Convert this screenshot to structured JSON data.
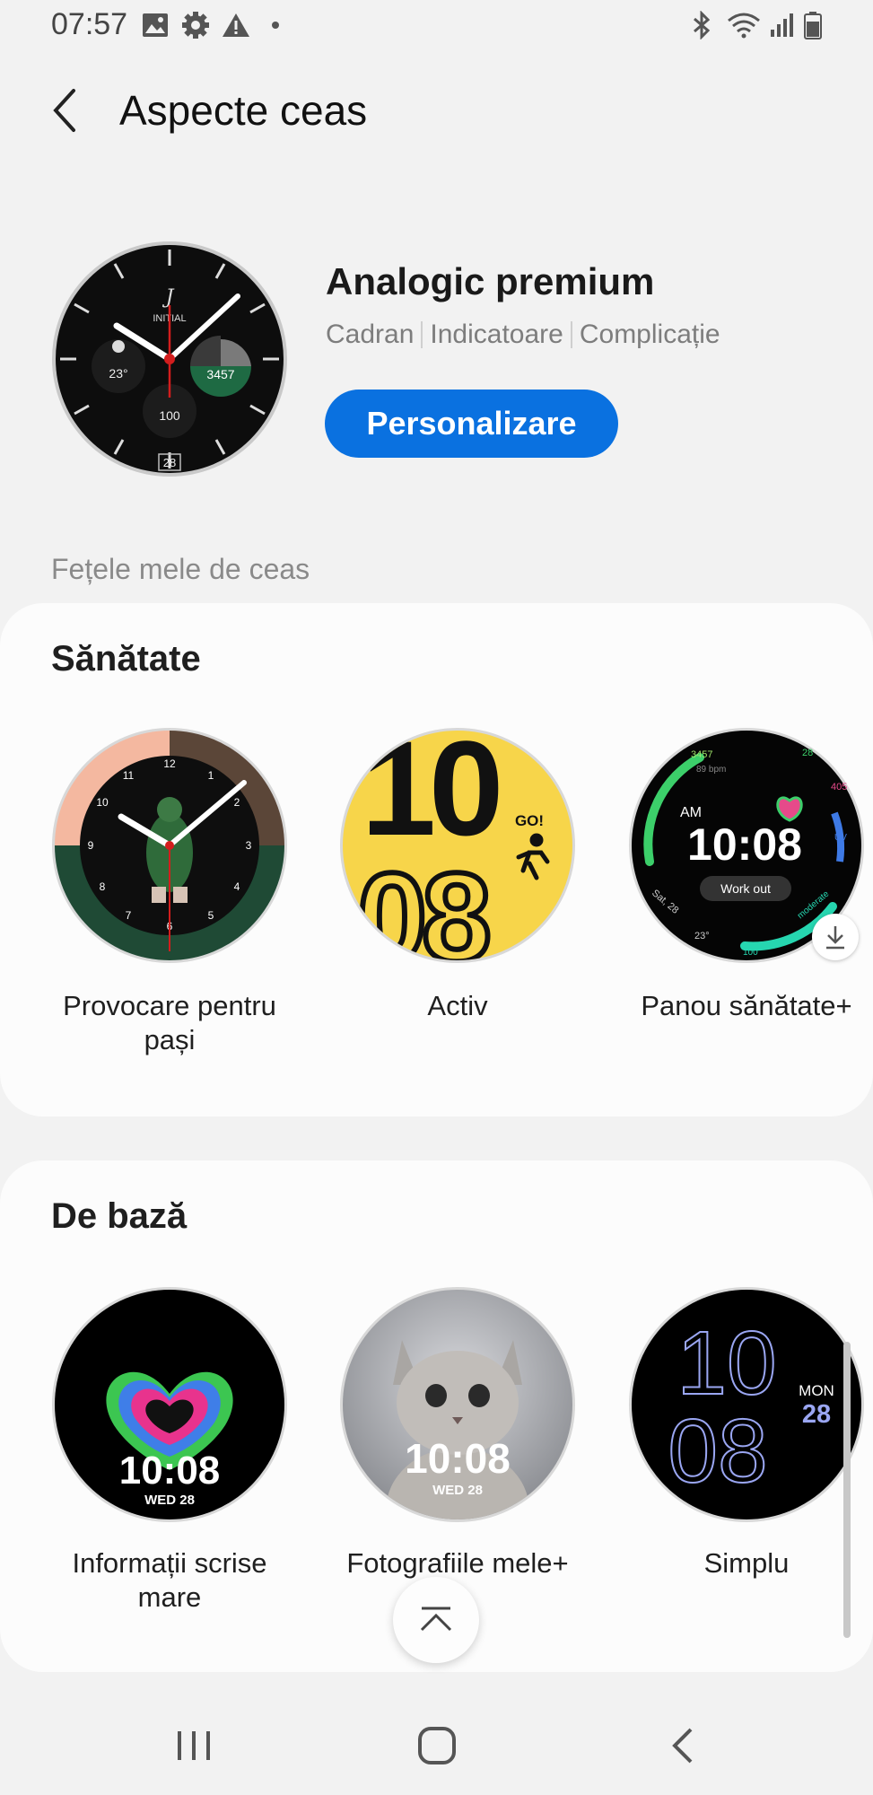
{
  "status_bar": {
    "time": "07:57",
    "left_icons": [
      "gallery-icon",
      "settings-icon",
      "warning-icon",
      "dot-icon"
    ],
    "right_icons": [
      "bluetooth-icon",
      "wifi-icon",
      "signal-icon",
      "battery-icon"
    ]
  },
  "header": {
    "title": "Aspecte ceas",
    "back_icon": "back-arrow-icon"
  },
  "current_face": {
    "name": "Analogic premium",
    "subitems": [
      "Cadran",
      "Indicatoare",
      "Complicație"
    ],
    "customize_label": "Personalizare",
    "face_text": {
      "brand": "INITIAL",
      "temp": "23°",
      "steps": "3457",
      "value": "100",
      "date": "28"
    }
  },
  "section_caption": "Fețele mele de ceas",
  "health": {
    "title": "Sănătate",
    "faces": [
      {
        "label_line1": "Provocare pentru",
        "label_line2": "pași"
      },
      {
        "label_line1": "Activ",
        "label_line2": ""
      },
      {
        "label_line1": "Panou sănătate+",
        "label_line2": ""
      }
    ],
    "activ_text": {
      "hour": "10",
      "minute": "08",
      "go": "GO!"
    },
    "panel_text": {
      "steps": "3457",
      "bpm": "89 bpm",
      "ampm": "AM",
      "time": "10:08",
      "workout": "Work out",
      "num1": "28",
      "num2": "405",
      "uv": "UV",
      "moderate": "moderate",
      "date": "Sat, 28",
      "temp": "23°",
      "bottom": "100"
    }
  },
  "basic": {
    "title": "De bază",
    "faces": [
      {
        "label_line1": "Informații scrise",
        "label_line2": "mare"
      },
      {
        "label_line1": "Fotografiile mele+",
        "label_line2": ""
      },
      {
        "label_line1": "Simplu",
        "label_line2": ""
      }
    ],
    "info_text": {
      "time": "10:08",
      "date": "WED 28"
    },
    "photo_text": {
      "time": "10:08",
      "date": "WED 28"
    },
    "simple_text": {
      "hour": "10",
      "minute": "08",
      "day": "MON",
      "date": "28"
    }
  },
  "nav": {
    "recent_icon": "recent-apps-icon",
    "home_icon": "home-icon",
    "back_icon": "back-icon",
    "scroll_top_icon": "scroll-to-top-icon"
  },
  "colors": {
    "accent": "#0a71e0",
    "background": "#f2f2f2",
    "card": "#fcfcfc"
  }
}
